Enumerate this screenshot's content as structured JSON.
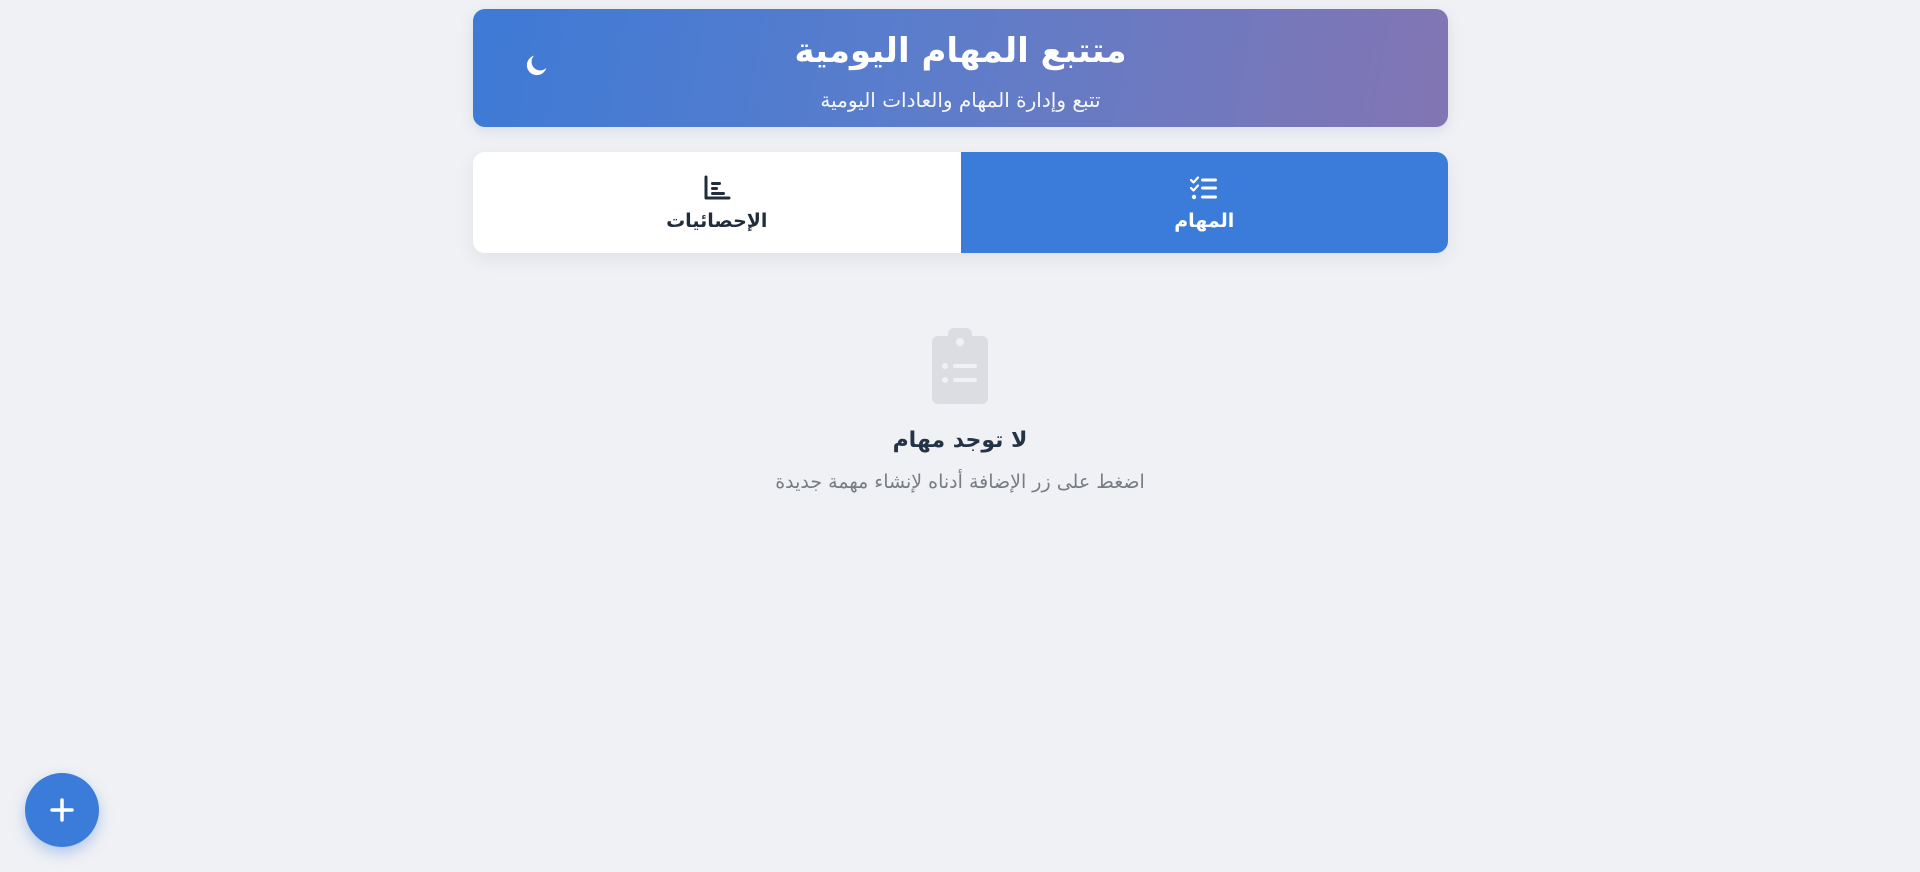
{
  "header": {
    "title": "متتبع المهام اليومية",
    "subtitle": "تتبع وإدارة المهام والعادات اليومية",
    "theme_icon": "moon-icon"
  },
  "tabs": [
    {
      "label": "المهام",
      "icon": "tasks-list-icon",
      "active": true
    },
    {
      "label": "الإحصائيات",
      "icon": "bar-chart-icon",
      "active": false
    }
  ],
  "empty_state": {
    "icon": "clipboard-list-icon",
    "title": "لا توجد مهام",
    "description": "اضغط على زر الإضافة أدناه لإنشاء مهمة جديدة"
  },
  "fab": {
    "icon": "plus-icon"
  },
  "colors": {
    "primary": "#3b7bd9",
    "header_gradient_start": "#3d7ad6",
    "header_gradient_end": "#8375b3",
    "background": "#f0f1f5",
    "text_dark": "#243447",
    "text_muted": "#777c85"
  }
}
